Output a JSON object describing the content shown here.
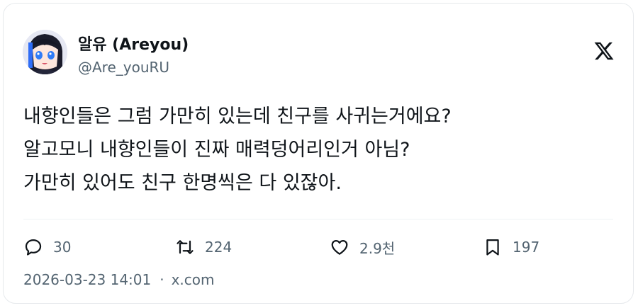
{
  "author": {
    "display_name": "알유 (Areyou)",
    "handle": "@Are_youRU"
  },
  "tweet": {
    "lines": [
      "내향인들은 그럼 가만히 있는데 친구를 사귀는거에요?",
      "알고모니 내향인들이 진짜 매력덩어리인거 아님?",
      "가만히 있어도 친구 한명씩은 다 있잖아."
    ]
  },
  "actions": {
    "replies": "30",
    "retweets": "224",
    "likes": "2.9천",
    "bookmarks": "197"
  },
  "meta": {
    "timestamp": "2026-03-23 14:01",
    "separator": "·",
    "source": "x.com"
  },
  "icons": {
    "brand": "x-logo-icon",
    "reply": "speech-bubble-icon",
    "retweet": "retweet-arrows-icon",
    "like": "heart-icon",
    "bookmark": "bookmark-icon"
  },
  "colors": {
    "text": "#0f1419",
    "secondary": "#536471",
    "border": "#e6e9ec"
  }
}
